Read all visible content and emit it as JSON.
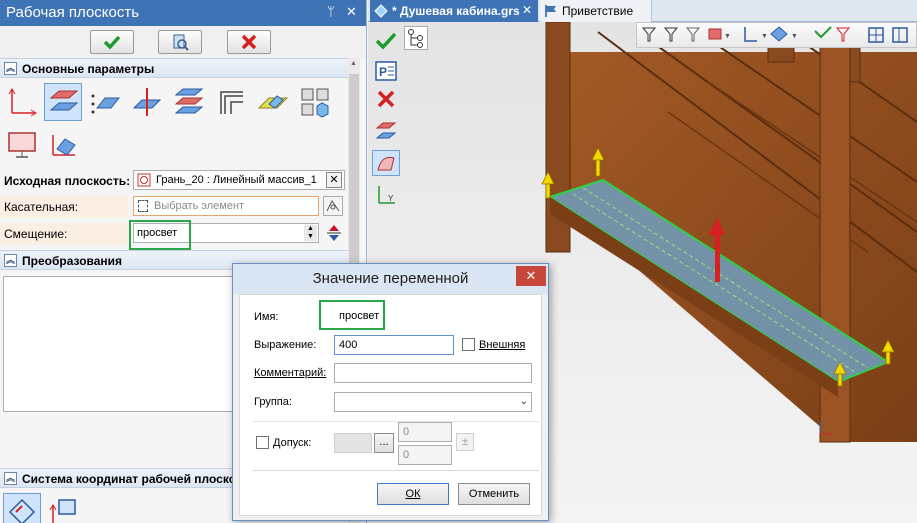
{
  "panel": {
    "title": "Рабочая плоскость",
    "pin_glyph": "ᛘ",
    "close_glyph": "✕"
  },
  "toolbar": {
    "ok_icon": "check-icon",
    "preview_icon": "preview-icon",
    "cancel_icon": "cross-icon"
  },
  "sections": {
    "main_params": "Основные параметры",
    "transforms": "Преобразования",
    "coord_system": "Система координат рабочей плоскости"
  },
  "fields": {
    "source_plane_label": "Исходная плоскость:",
    "source_plane_value": "Грань_20 : Линейный массив_1",
    "tangent_label": "Касательная:",
    "tangent_placeholder": "Выбрать элемент",
    "offset_label": "Смещение:",
    "offset_value": "просвет"
  },
  "tabs": [
    {
      "label": "* Душевая кабина.grs",
      "active": true
    },
    {
      "label": "Приветствие",
      "active": false
    }
  ],
  "dialog": {
    "title": "Значение переменной",
    "close_glyph": "✕",
    "name_label": "Имя:",
    "name_value": "просвет",
    "expression_label": "Выражение:",
    "expression_value": "400",
    "external_label": "Внешняя",
    "comment_label": "Комментарий:",
    "group_label": "Группа:",
    "tolerance_label": "Допуск:",
    "tolerance_button": "...",
    "tolerance_upper": "0",
    "tolerance_lower": "0",
    "plusminus": "±",
    "ok_button": "ОК",
    "cancel_button": "Отменить"
  },
  "colors": {
    "accent_blue": "#3e73b5",
    "highlight_green": "#29a84a",
    "wood": "#8a4a1f",
    "selection_cyan": "#4aa3d6",
    "arrow_red": "#d92020",
    "arrow_yellow": "#f5d800"
  }
}
